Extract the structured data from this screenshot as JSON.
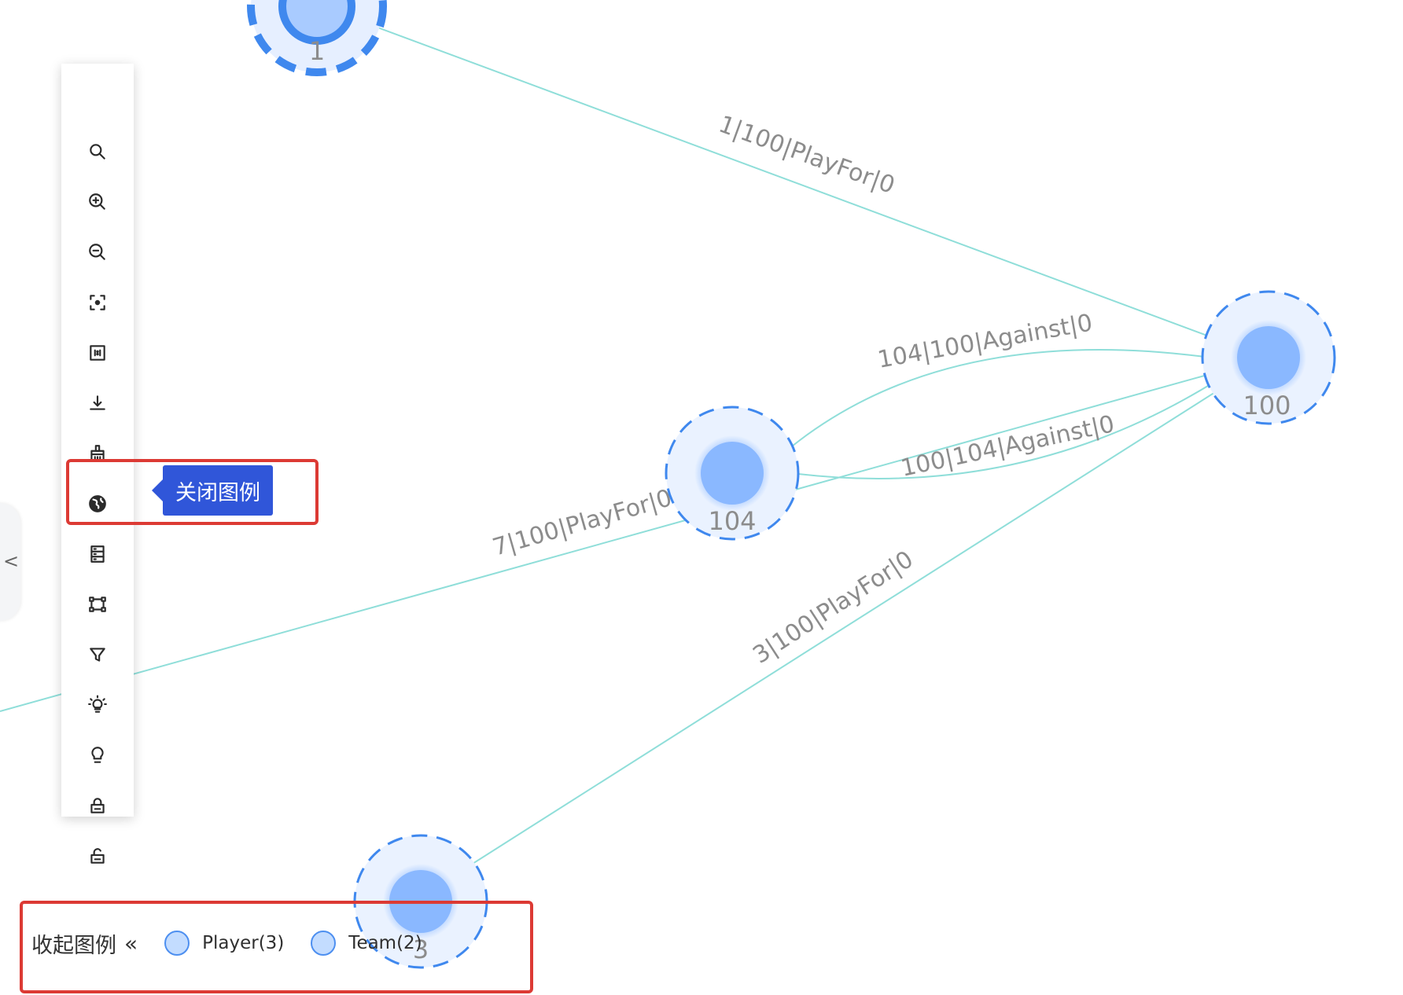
{
  "graph": {
    "nodes": [
      {
        "id": "1",
        "label": "1",
        "type": "Player",
        "selected": true
      },
      {
        "id": "100",
        "label": "100",
        "type": "Team",
        "selected": false
      },
      {
        "id": "104",
        "label": "104",
        "type": "Team",
        "selected": false
      },
      {
        "id": "3",
        "label": "3",
        "type": "Player",
        "selected": false
      }
    ],
    "edges": [
      {
        "label": "1|100|PlayFor|0",
        "source": "1",
        "target": "100"
      },
      {
        "label": "104|100|Against|0",
        "source": "104",
        "target": "100"
      },
      {
        "label": "100|104|Against|0",
        "source": "100",
        "target": "104"
      },
      {
        "label": "7|100|PlayFor|0",
        "source": "7",
        "target": "100"
      },
      {
        "label": "3|100|PlayFor|0",
        "source": "3",
        "target": "100"
      }
    ],
    "colors": {
      "edge": "#8fded9",
      "node_fill": "#8ab8ff",
      "node_ring": "#4d8ff0",
      "halo": "#e6efff"
    }
  },
  "toolbar": {
    "items": [
      {
        "name": "search-icon",
        "icon": "search"
      },
      {
        "name": "zoom-in-icon",
        "icon": "zoom-in"
      },
      {
        "name": "zoom-out-icon",
        "icon": "zoom-out"
      },
      {
        "name": "focus-center-icon",
        "icon": "focus"
      },
      {
        "name": "actual-size-icon",
        "icon": "one-to-one"
      },
      {
        "name": "download-icon",
        "icon": "download"
      },
      {
        "name": "clear-canvas-icon",
        "icon": "broom"
      },
      {
        "name": "globe-icon",
        "icon": "globe"
      },
      {
        "name": "legend-toggle-icon",
        "icon": "legend"
      },
      {
        "name": "fit-view-icon",
        "icon": "fit"
      },
      {
        "name": "filter-icon",
        "icon": "filter"
      },
      {
        "name": "highlight-on-icon",
        "icon": "bulb-on"
      },
      {
        "name": "highlight-off-icon",
        "icon": "bulb-off"
      },
      {
        "name": "lock-icon",
        "icon": "lock"
      },
      {
        "name": "unlock-icon",
        "icon": "unlock"
      }
    ],
    "tooltip": "关闭图例"
  },
  "legend": {
    "title": "收起图例",
    "collapse_icon": "«",
    "items": [
      {
        "label": "Player(3)"
      },
      {
        "label": "Team(2)"
      }
    ]
  },
  "side_handle": {
    "icon": "<"
  }
}
